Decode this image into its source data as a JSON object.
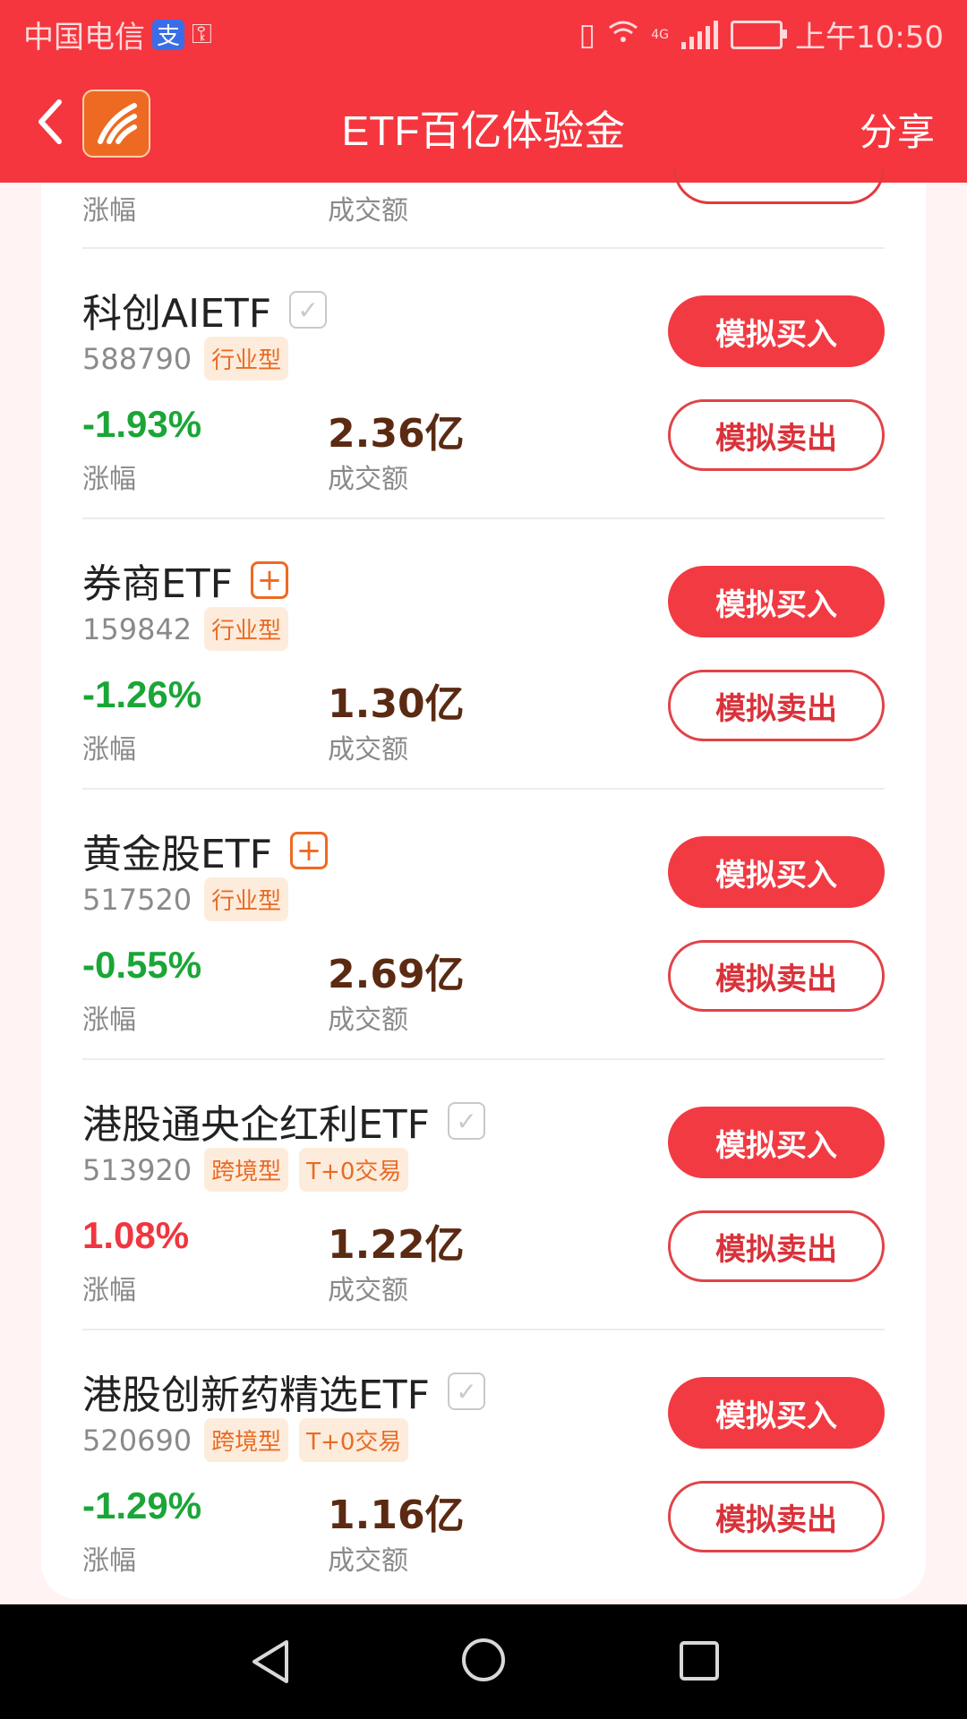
{
  "status_bar": {
    "carrier": "中国电信",
    "alipay_badge": "支",
    "time": "上午10:50",
    "network": "4G"
  },
  "header": {
    "title": "ETF百亿体验金",
    "share_label": "分享"
  },
  "partial_top_row": {
    "change_label": "涨幅",
    "volume_label": "成交额"
  },
  "funds": [
    {
      "name": "科创AIETF",
      "code": "588790",
      "tags": [
        "行业型"
      ],
      "change": "-1.93%",
      "direction": "down",
      "change_label": "涨幅",
      "volume": "2.36亿",
      "volume_label": "成交额",
      "mark": "check",
      "buy_label": "模拟买入",
      "sell_label": "模拟卖出"
    },
    {
      "name": "券商ETF",
      "code": "159842",
      "tags": [
        "行业型"
      ],
      "change": "-1.26%",
      "direction": "down",
      "change_label": "涨幅",
      "volume": "1.30亿",
      "volume_label": "成交额",
      "mark": "add",
      "buy_label": "模拟买入",
      "sell_label": "模拟卖出"
    },
    {
      "name": "黄金股ETF",
      "code": "517520",
      "tags": [
        "行业型"
      ],
      "change": "-0.55%",
      "direction": "down",
      "change_label": "涨幅",
      "volume": "2.69亿",
      "volume_label": "成交额",
      "mark": "add",
      "buy_label": "模拟买入",
      "sell_label": "模拟卖出"
    },
    {
      "name": "港股通央企红利ETF",
      "code": "513920",
      "tags": [
        "跨境型",
        "T+0交易"
      ],
      "change": "1.08%",
      "direction": "up",
      "change_label": "涨幅",
      "volume": "1.22亿",
      "volume_label": "成交额",
      "mark": "check",
      "buy_label": "模拟买入",
      "sell_label": "模拟卖出"
    },
    {
      "name": "港股创新药精选ETF",
      "code": "520690",
      "tags": [
        "跨境型",
        "T+0交易"
      ],
      "change": "-1.29%",
      "direction": "down",
      "change_label": "涨幅",
      "volume": "1.16亿",
      "volume_label": "成交额",
      "mark": "check",
      "buy_label": "模拟买入",
      "sell_label": "模拟卖出"
    }
  ],
  "colors": {
    "brand_red": "#f5363f",
    "down_green": "#1aa637",
    "up_red": "#f0363f",
    "tag_orange": "#e86b25"
  },
  "icons": {
    "back": "chevron-left-icon",
    "logo": "app-logo",
    "check": "check-icon",
    "add": "plus-box-icon"
  }
}
